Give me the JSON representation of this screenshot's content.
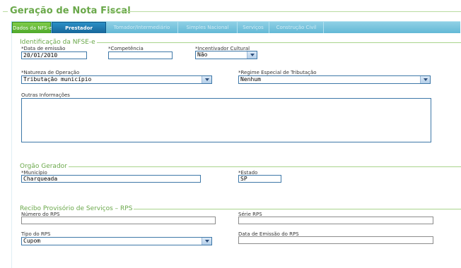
{
  "page": {
    "title": "Geração de Nota Fiscal"
  },
  "tabs": [
    {
      "label": "Dados da NFS-e",
      "state": "active-green"
    },
    {
      "label": "Prestador",
      "state": "active-blue"
    },
    {
      "label": "Tomador/Intermediário",
      "state": "disabled"
    },
    {
      "label": "Simples Nacional",
      "state": "disabled"
    },
    {
      "label": "Serviços",
      "state": "disabled"
    },
    {
      "label": "Construção Civil",
      "state": "disabled"
    }
  ],
  "identificacao": {
    "title": "Identificação da NFSE-e",
    "data_emissao": {
      "label": "*Data de emissão",
      "value": "20/01/2010"
    },
    "competencia": {
      "label": "*Competência",
      "value": ""
    },
    "incentivador": {
      "label": "*Incentivador Cultural",
      "value": "Não"
    },
    "natureza": {
      "label": "*Natureza de Operação",
      "value": "Tributação município"
    },
    "regime": {
      "label": "*Regime Especial de Tributação",
      "value": "Nenhum"
    },
    "outras": {
      "label": "Outras Informações",
      "value": ""
    }
  },
  "orgao": {
    "title": "Orgão Gerador",
    "municipio": {
      "label": "*Município",
      "value": "Charqueada"
    },
    "estado": {
      "label": "*Estado",
      "value": "SP"
    }
  },
  "rps": {
    "title": "Recibo Provisório de Serviços – RPS",
    "numero": {
      "label": "Número do RPS",
      "value": ""
    },
    "serie": {
      "label": "Série RPS",
      "value": ""
    },
    "tipo": {
      "label": "Tipo do RPS",
      "value": "Cupom"
    },
    "data_emissao": {
      "label": "Data de Emissão do RPS",
      "value": ""
    }
  },
  "colors": {
    "accent_green": "#6aa84a",
    "tab_bar": "#63b9d6",
    "input_border": "#3e78a8"
  }
}
